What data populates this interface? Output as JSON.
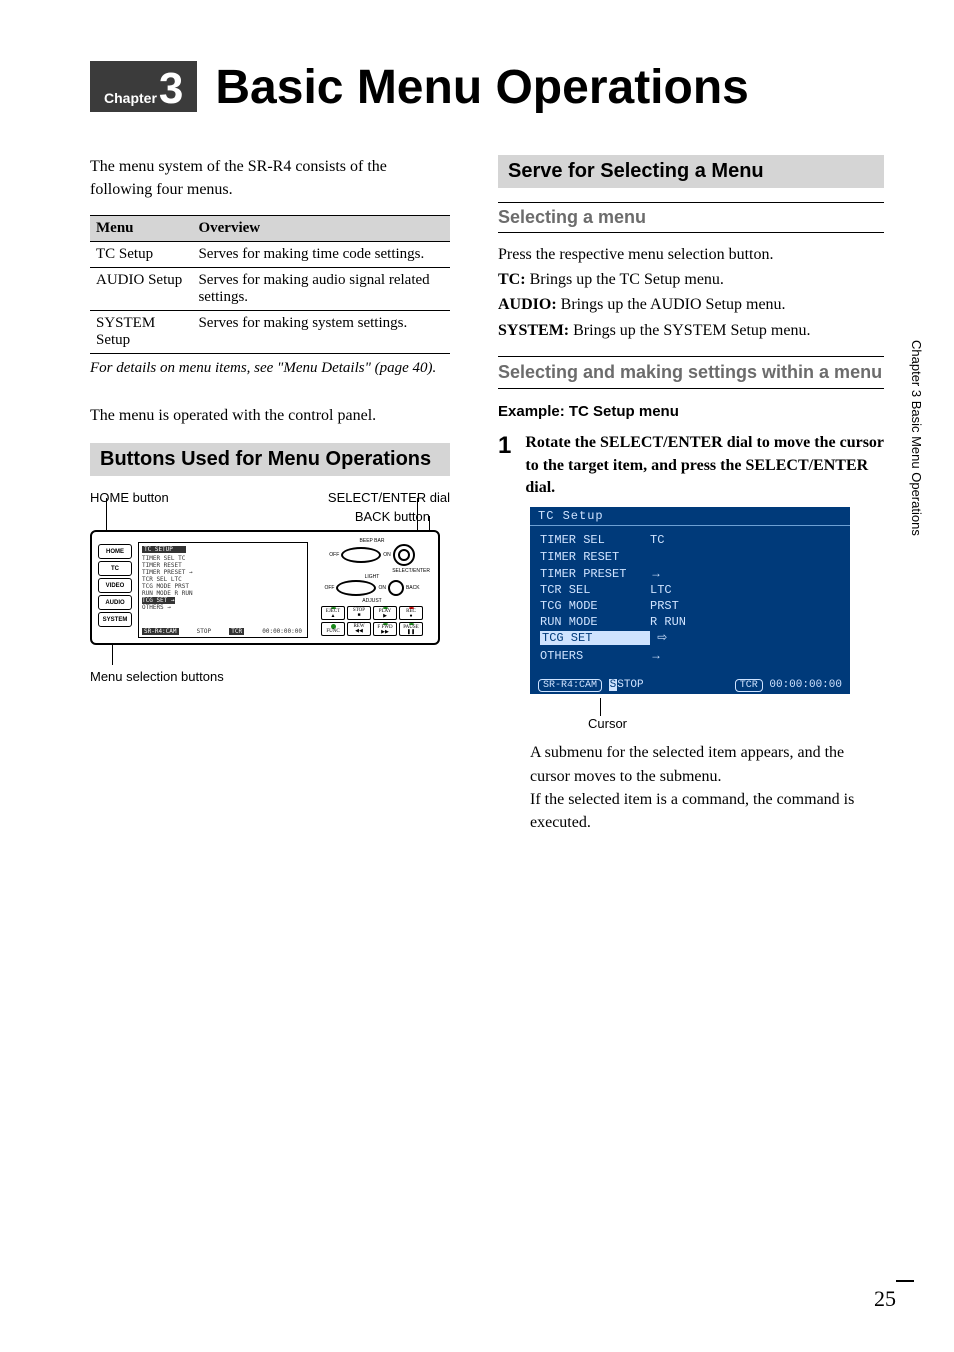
{
  "chapter": {
    "word": "Chapter",
    "num": "3",
    "title": "Basic Menu Operations"
  },
  "intro": "The menu system of the SR-R4 consists of the following four menus.",
  "table": {
    "headers": [
      "Menu",
      "Overview"
    ],
    "rows": [
      {
        "menu": "TC Setup",
        "overview": "Serves for making time code settings."
      },
      {
        "menu": "AUDIO Setup",
        "overview": "Serves for making audio signal related settings."
      },
      {
        "menu": "SYSTEM Setup",
        "overview": "Serves for making system settings."
      }
    ]
  },
  "crossref": "For details on menu items, see \"Menu Details\" (page 40).",
  "panel_note": "The menu is operated with the control panel.",
  "section_buttons": "Buttons Used for Menu Operations",
  "panel_labels": {
    "home": "HOME button",
    "select": "SELECT/ENTER dial",
    "back": "BACK button",
    "menu_sel": "Menu selection buttons"
  },
  "panel_lcd": {
    "header": "TC SETUP",
    "lines": [
      "TIMER SEL       TC",
      "TIMER RESET",
      "TIMER PRESET    →",
      "TCR SEL         LTC",
      "TCG MODE        PRST",
      "RUN MODE        R RUN",
      "TCG SET         →",
      "OTHERS          →"
    ],
    "footer_left": "SR-R4:CAM",
    "footer_mid": "STOP",
    "footer_tc_lbl": "TCR",
    "footer_tc": "00:00:00:00"
  },
  "panel_btns": {
    "home": "HOME",
    "tc": "TC",
    "video": "VIDEO",
    "audio": "AUDIO",
    "system": "SYSTEM",
    "beep": "BEEP BAR",
    "select_enter": "SELECT/ENTER",
    "light": "LIGHT",
    "adjust": "ADJUST",
    "back": "BACK",
    "eject": "EJECT",
    "stop": "STOP",
    "play": "PLAY",
    "rec": "REC",
    "func": "FUNC",
    "rew": "REW",
    "ffwd": "F FWD",
    "pause": "PAUSE",
    "on": "ON",
    "off": "OFF"
  },
  "section_serve": "Serve for Selecting a Menu",
  "sub_selecting": "Selecting a menu",
  "selecting_body": "Press the respective menu selection button.",
  "selecting_items": [
    {
      "label": "TC:",
      "desc": " Brings up the TC Setup menu."
    },
    {
      "label": "AUDIO:",
      "desc": " Brings up the AUDIO Setup menu."
    },
    {
      "label": "SYSTEM:",
      "desc": " Brings up the SYSTEM Setup menu."
    }
  ],
  "sub_making": "Selecting and making settings within a menu",
  "example_heading": "Example: TC Setup menu",
  "step1": {
    "num": "1",
    "text": "Rotate the SELECT/ENTER dial to move the cursor to the target item, and press the SELECT/ENTER dial."
  },
  "tc_screen": {
    "title": "TC Setup",
    "rows": [
      {
        "l": "TIMER SEL",
        "r": "TC"
      },
      {
        "l": "TIMER RESET",
        "r": ""
      },
      {
        "l": "TIMER PRESET",
        "r": "→"
      },
      {
        "l": "TCR SEL",
        "r": "LTC"
      },
      {
        "l": "TCG MODE",
        "r": "PRST"
      },
      {
        "l": "RUN MODE",
        "r": "R RUN"
      },
      {
        "l": "TCG SET",
        "r": "⇨",
        "hl": true
      },
      {
        "l": "OTHERS",
        "r": "→"
      }
    ],
    "footer_left": "SR-R4:CAM",
    "footer_stop": "STOP",
    "footer_tcr": "TCR",
    "footer_time": "00:00:00:00"
  },
  "cursor_label": "Cursor",
  "submenu_para1": "A submenu for the selected item appears, and the cursor moves to the submenu.",
  "submenu_para2": "If the selected item is a command, the command is executed.",
  "side": "Chapter 3  Basic Menu Operations",
  "page": "25"
}
